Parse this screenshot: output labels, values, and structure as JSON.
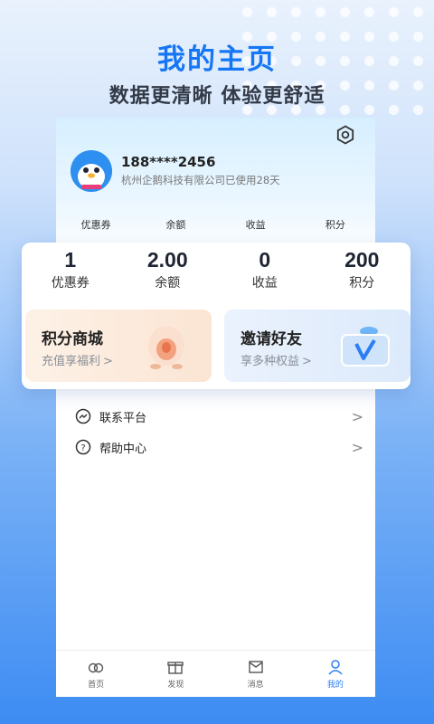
{
  "promo": {
    "headline": "我的主页",
    "subline": "数据更清晰 体验更舒适"
  },
  "profile": {
    "phone": "188****2456",
    "company": "杭州企鹅科技有限公司已使用28天"
  },
  "mini_stats": [
    "优惠券",
    "余额",
    "收益",
    "积分"
  ],
  "stats": [
    {
      "value": "1",
      "label": "优惠券"
    },
    {
      "value": "2.00",
      "label": "余额"
    },
    {
      "value": "0",
      "label": "收益"
    },
    {
      "value": "200",
      "label": "积分"
    }
  ],
  "cards": {
    "shop": {
      "title": "积分商城",
      "subtitle": "充值享福利",
      "arrow": ">"
    },
    "invite": {
      "title": "邀请好友",
      "subtitle": "享多种权益",
      "arrow": ">"
    }
  },
  "menu": [
    {
      "label": "联系平台",
      "icon": "handshake-icon",
      "arrow": ">"
    },
    {
      "label": "帮助中心",
      "icon": "help-icon",
      "arrow": ">"
    }
  ],
  "tabs": [
    {
      "label": "首页",
      "icon": "home-icon"
    },
    {
      "label": "发现",
      "icon": "gift-icon"
    },
    {
      "label": "消息",
      "icon": "mail-icon"
    },
    {
      "label": "我的",
      "icon": "user-icon",
      "active": true
    }
  ],
  "colors": {
    "accent": "#1677f5",
    "active_tab": "#2a7df4"
  }
}
